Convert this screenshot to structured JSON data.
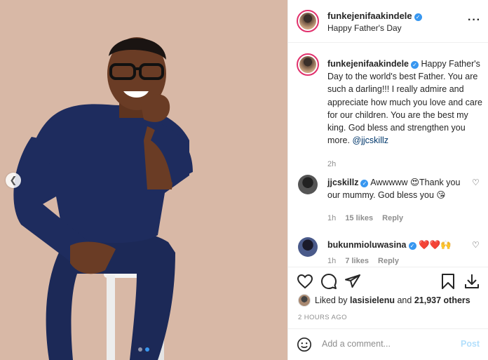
{
  "post": {
    "username": "funkejenifaakindele",
    "subtitle": "Happy Father's Day",
    "more_icon": "more-horizontal-icon"
  },
  "caption": {
    "username": "funkejenifaakindele",
    "text": "Happy Father's Day to the world's best Father. You are such a darling!!! I really admire and appreciate how much you love and care for our children. You are the best my king. God bless and strengthen you more.",
    "mention": "@jjcskillz",
    "time": "2h"
  },
  "comments": [
    {
      "username": "jjcskillz",
      "text": "Awwwww 😍Thank you our mummy. God bless you 😘",
      "time": "1h",
      "likes": "15 likes",
      "reply": "Reply"
    },
    {
      "username": "bukunmioluwasina",
      "text": "❤️❤️🙌",
      "time": "1h",
      "likes": "7 likes",
      "reply": "Reply"
    }
  ],
  "likes": {
    "prefix": "Liked by",
    "user": "lasisielenu",
    "joiner": "and",
    "others": "21,937 others"
  },
  "timestamp": "2 HOURS AGO",
  "composer": {
    "placeholder": "Add a comment...",
    "post_label": "Post"
  },
  "colors": {
    "accent": "#3897f0",
    "photo_bg": "#d7b9a8",
    "outfit": "#1d2a5a"
  }
}
